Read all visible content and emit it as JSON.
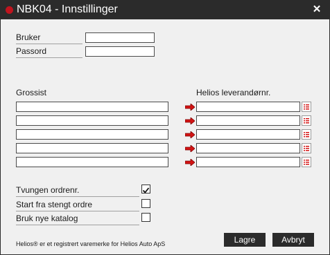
{
  "window": {
    "title": "NBK04 - Innstillinger",
    "close_glyph": "✕",
    "titlebar_color": "#2b2b2b",
    "status_dot_color": "#c0141e"
  },
  "login": {
    "user_label": "Bruker",
    "user_value": "",
    "password_label": "Passord",
    "password_value": ""
  },
  "mapping": {
    "wholesaler_header": "Grossist",
    "supplier_header": "Helios leverandørnr.",
    "arrow_icon": "red-right-arrow-icon",
    "list_icon": "list-icon",
    "rows": [
      {
        "wholesaler": "",
        "supplier": ""
      },
      {
        "wholesaler": "",
        "supplier": ""
      },
      {
        "wholesaler": "",
        "supplier": ""
      },
      {
        "wholesaler": "",
        "supplier": ""
      },
      {
        "wholesaler": "",
        "supplier": ""
      }
    ]
  },
  "options": [
    {
      "label": "Tvungen ordrenr.",
      "checked": true
    },
    {
      "label": "Start fra stengt ordre",
      "checked": false
    },
    {
      "label": "Bruk nye katalog",
      "checked": false
    }
  ],
  "footer": {
    "trademark": "Helios® er et registrert varemerke for Helios Auto ApS",
    "save_label": "Lagre",
    "cancel_label": "Avbryt"
  }
}
